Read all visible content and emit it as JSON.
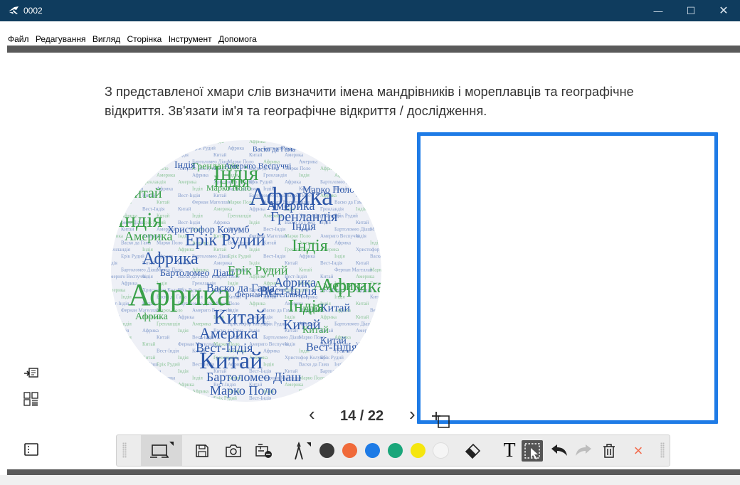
{
  "window": {
    "title": "0002",
    "minimize_glyph": "—",
    "maximize_glyph": "☐",
    "close_glyph": "✕"
  },
  "menu": [
    "Файл",
    "Редагування",
    "Вигляд",
    "Сторінка",
    "Інструмент",
    "Допомога"
  ],
  "task": {
    "line1": "З представленої хмари слів визначити імена мандрівників і мореплавців та географічне",
    "line2": "відкриття. Зв'язати ім'я та географічне відкриття / дослідження."
  },
  "pagination": {
    "prev": "‹",
    "next": "›",
    "label": "14 / 22"
  },
  "word_cloud": {
    "words": [
      {
        "text": "Африка",
        "color": "#2d57a8"
      },
      {
        "text": "Індія",
        "color": "#3aa04a"
      },
      {
        "text": "Гренландія",
        "color": "#2d57a8"
      },
      {
        "text": "Індія",
        "color": "#3aa04a"
      },
      {
        "text": "Африка",
        "color": "#3aa04a"
      },
      {
        "text": "Китай",
        "color": "#3aa04a"
      },
      {
        "text": "Індія",
        "color": "#3aa04a"
      },
      {
        "text": "Гренландія",
        "color": "#3aa04a"
      },
      {
        "text": "Америка",
        "color": "#3aa04a"
      },
      {
        "text": "Христофор Колумб",
        "color": "#2d57a8"
      },
      {
        "text": "Ерік Рудий",
        "color": "#2d57a8"
      },
      {
        "text": "Африка",
        "color": "#2d57a8"
      },
      {
        "text": "Бартоломео Діаш",
        "color": "#2d57a8"
      },
      {
        "text": "Ерік Рудий",
        "color": "#3aa04a"
      },
      {
        "text": "Вест-Індія",
        "color": "#2d57a8"
      },
      {
        "text": "Африка",
        "color": "#2d57a8"
      },
      {
        "text": "Індія",
        "color": "#3aa04a"
      },
      {
        "text": "Васко да Гама",
        "color": "#2d57a8"
      },
      {
        "text": "Індія",
        "color": "#2d57a8"
      },
      {
        "text": "Китай",
        "color": "#2d57a8"
      },
      {
        "text": "Китай",
        "color": "#2d57a8"
      },
      {
        "text": "Америка",
        "color": "#2d57a8"
      },
      {
        "text": "Індія",
        "color": "#3aa04a"
      },
      {
        "text": "Китай",
        "color": "#2d57a8"
      },
      {
        "text": "Вест-Індія",
        "color": "#2d57a8"
      },
      {
        "text": "Китай",
        "color": "#2d57a8"
      },
      {
        "text": "Бартоломео Діаш",
        "color": "#2d57a8"
      },
      {
        "text": "Марко Поло",
        "color": "#2d57a8"
      },
      {
        "text": "Африка",
        "color": "#3aa04a"
      },
      {
        "text": "Америка",
        "color": "#2d57a8"
      },
      {
        "text": "Індія",
        "color": "#3aa04a"
      },
      {
        "text": "Китай",
        "color": "#3aa04a"
      },
      {
        "text": "Фернан Магеллан",
        "color": "#2d57a8"
      },
      {
        "text": "Марко Поло",
        "color": "#3aa04a"
      },
      {
        "text": "Америго Веспуччі",
        "color": "#2d57a8"
      },
      {
        "text": "Індія",
        "color": "#2d57a8"
      },
      {
        "text": "Васко да Гама",
        "color": "#2d57a8"
      },
      {
        "text": "Марко Поло",
        "color": "#2d57a8"
      },
      {
        "text": "Африка",
        "color": "#3aa04a"
      },
      {
        "text": "Вест-Індія",
        "color": "#2d57a8"
      },
      {
        "text": "Китай",
        "color": "#2d57a8"
      },
      {
        "text": "Америка",
        "color": "#3aa04a"
      }
    ]
  },
  "toolbar": {
    "colors": [
      "#3a3a3a",
      "#f06a3a",
      "#1e7be6",
      "#1aa67a",
      "#f5e60e",
      "#f5f5f5"
    ],
    "text_tool": "T",
    "close_glyph": "×",
    "icons": [
      "whiteboard-icon",
      "save-icon",
      "camera-icon",
      "capture-icon",
      "pen-icon",
      "eraser-icon",
      "text-icon",
      "select-icon",
      "undo-icon",
      "redo-icon",
      "delete-icon",
      "close-icon"
    ]
  },
  "side": {
    "icons": [
      "import-icon",
      "grid-icon",
      "panel-icon"
    ]
  }
}
